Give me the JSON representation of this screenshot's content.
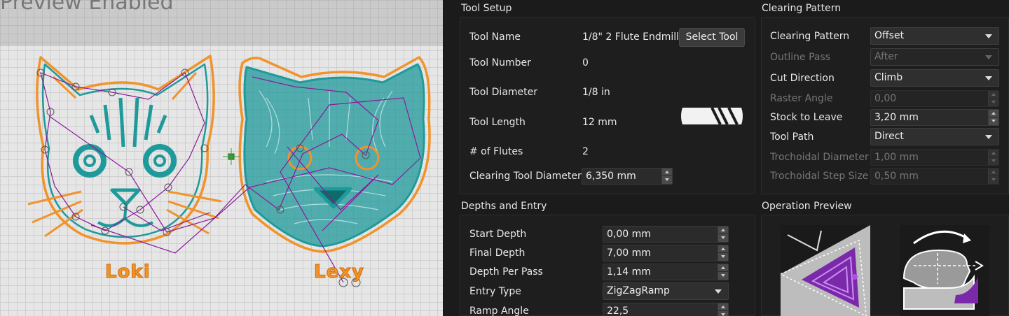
{
  "canvas": {
    "banner": "Preview Enabled",
    "labels": {
      "left_cat": "Loki",
      "right_cat": "Lexy"
    }
  },
  "tool_setup": {
    "title": "Tool Setup",
    "tool_name_label": "Tool Name",
    "tool_name_value": "1/8\" 2 Flute Endmill",
    "select_tool_label": "Select Tool",
    "tool_number_label": "Tool Number",
    "tool_number_value": "0",
    "tool_diameter_label": "Tool Diameter",
    "tool_diameter_value": "1/8 in",
    "tool_length_label": "Tool Length",
    "tool_length_value": "12 mm",
    "flutes_label": "# of Flutes",
    "flutes_value": "2",
    "clearing_diameter_label": "Clearing Tool Diameter",
    "clearing_diameter_value": "6,350 mm"
  },
  "clearing_pattern": {
    "title": "Clearing Pattern",
    "pattern_label": "Clearing Pattern",
    "pattern_value": "Offset",
    "outline_pass_label": "Outline Pass",
    "outline_pass_value": "After",
    "cut_direction_label": "Cut Direction",
    "cut_direction_value": "Climb",
    "raster_angle_label": "Raster Angle",
    "raster_angle_value": "0,00",
    "stock_label": "Stock to Leave",
    "stock_value": "3,20 mm",
    "tool_path_label": "Tool Path",
    "tool_path_value": "Direct",
    "troch_diameter_label": "Trochoidal Diameter",
    "troch_diameter_value": "1,00 mm",
    "troch_step_label": "Trochoidal Step Size",
    "troch_step_value": "0,50 mm"
  },
  "depths": {
    "title": "Depths and Entry",
    "start_label": "Start Depth",
    "start_value": "0,00 mm",
    "final_label": "Final Depth",
    "final_value": "7,00 mm",
    "per_pass_label": "Depth Per Pass",
    "per_pass_value": "1,14 mm",
    "entry_label": "Entry Type",
    "entry_value": "ZigZagRamp",
    "ramp_label": "Ramp Angle",
    "ramp_value": "22,5"
  },
  "operation_preview": {
    "title": "Operation Preview"
  },
  "colors": {
    "accent_orange": "#f1932b",
    "toolpath_teal": "#1f9a9a",
    "rapid_purple": "#8a1a9a",
    "panel_bg": "#1b1b1b"
  }
}
